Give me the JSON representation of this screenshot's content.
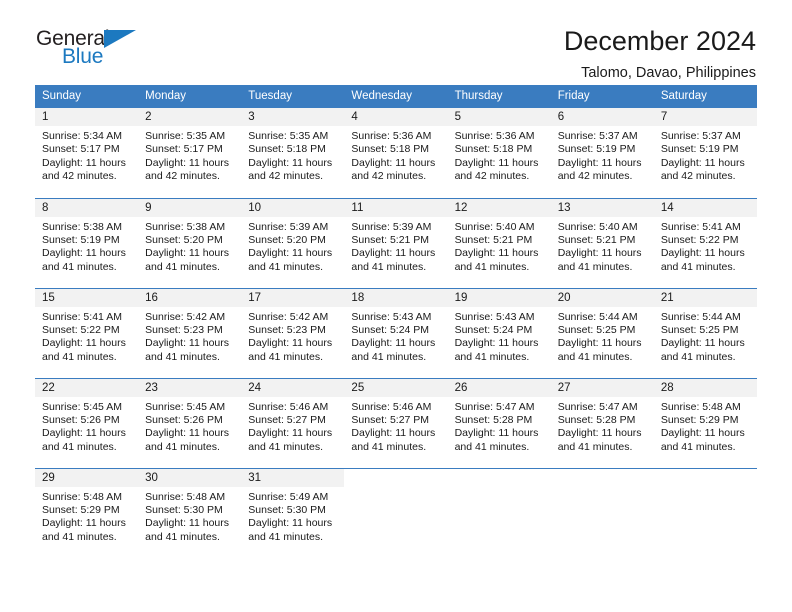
{
  "logo": {
    "primary_text": "General",
    "secondary_text": "Blue",
    "primary_color": "#231f20",
    "secondary_color": "#1c79c0",
    "triangle_icon": "triangle-icon"
  },
  "header": {
    "title": "December 2024",
    "subtitle": "Talomo, Davao, Philippines"
  },
  "theme": {
    "header_bg": "#3a7cc0",
    "daynum_bg": "#f2f2f2",
    "text": "#1a1a1a"
  },
  "weekday_headers": [
    "Sunday",
    "Monday",
    "Tuesday",
    "Wednesday",
    "Thursday",
    "Friday",
    "Saturday"
  ],
  "weeks": [
    [
      {
        "day": "1",
        "sunrise": "Sunrise: 5:34 AM",
        "sunset": "Sunset: 5:17 PM",
        "daylight_1": "Daylight: 11 hours",
        "daylight_2": "and 42 minutes."
      },
      {
        "day": "2",
        "sunrise": "Sunrise: 5:35 AM",
        "sunset": "Sunset: 5:17 PM",
        "daylight_1": "Daylight: 11 hours",
        "daylight_2": "and 42 minutes."
      },
      {
        "day": "3",
        "sunrise": "Sunrise: 5:35 AM",
        "sunset": "Sunset: 5:18 PM",
        "daylight_1": "Daylight: 11 hours",
        "daylight_2": "and 42 minutes."
      },
      {
        "day": "4",
        "sunrise": "Sunrise: 5:36 AM",
        "sunset": "Sunset: 5:18 PM",
        "daylight_1": "Daylight: 11 hours",
        "daylight_2": "and 42 minutes."
      },
      {
        "day": "5",
        "sunrise": "Sunrise: 5:36 AM",
        "sunset": "Sunset: 5:18 PM",
        "daylight_1": "Daylight: 11 hours",
        "daylight_2": "and 42 minutes."
      },
      {
        "day": "6",
        "sunrise": "Sunrise: 5:37 AM",
        "sunset": "Sunset: 5:19 PM",
        "daylight_1": "Daylight: 11 hours",
        "daylight_2": "and 42 minutes."
      },
      {
        "day": "7",
        "sunrise": "Sunrise: 5:37 AM",
        "sunset": "Sunset: 5:19 PM",
        "daylight_1": "Daylight: 11 hours",
        "daylight_2": "and 42 minutes."
      }
    ],
    [
      {
        "day": "8",
        "sunrise": "Sunrise: 5:38 AM",
        "sunset": "Sunset: 5:19 PM",
        "daylight_1": "Daylight: 11 hours",
        "daylight_2": "and 41 minutes."
      },
      {
        "day": "9",
        "sunrise": "Sunrise: 5:38 AM",
        "sunset": "Sunset: 5:20 PM",
        "daylight_1": "Daylight: 11 hours",
        "daylight_2": "and 41 minutes."
      },
      {
        "day": "10",
        "sunrise": "Sunrise: 5:39 AM",
        "sunset": "Sunset: 5:20 PM",
        "daylight_1": "Daylight: 11 hours",
        "daylight_2": "and 41 minutes."
      },
      {
        "day": "11",
        "sunrise": "Sunrise: 5:39 AM",
        "sunset": "Sunset: 5:21 PM",
        "daylight_1": "Daylight: 11 hours",
        "daylight_2": "and 41 minutes."
      },
      {
        "day": "12",
        "sunrise": "Sunrise: 5:40 AM",
        "sunset": "Sunset: 5:21 PM",
        "daylight_1": "Daylight: 11 hours",
        "daylight_2": "and 41 minutes."
      },
      {
        "day": "13",
        "sunrise": "Sunrise: 5:40 AM",
        "sunset": "Sunset: 5:21 PM",
        "daylight_1": "Daylight: 11 hours",
        "daylight_2": "and 41 minutes."
      },
      {
        "day": "14",
        "sunrise": "Sunrise: 5:41 AM",
        "sunset": "Sunset: 5:22 PM",
        "daylight_1": "Daylight: 11 hours",
        "daylight_2": "and 41 minutes."
      }
    ],
    [
      {
        "day": "15",
        "sunrise": "Sunrise: 5:41 AM",
        "sunset": "Sunset: 5:22 PM",
        "daylight_1": "Daylight: 11 hours",
        "daylight_2": "and 41 minutes."
      },
      {
        "day": "16",
        "sunrise": "Sunrise: 5:42 AM",
        "sunset": "Sunset: 5:23 PM",
        "daylight_1": "Daylight: 11 hours",
        "daylight_2": "and 41 minutes."
      },
      {
        "day": "17",
        "sunrise": "Sunrise: 5:42 AM",
        "sunset": "Sunset: 5:23 PM",
        "daylight_1": "Daylight: 11 hours",
        "daylight_2": "and 41 minutes."
      },
      {
        "day": "18",
        "sunrise": "Sunrise: 5:43 AM",
        "sunset": "Sunset: 5:24 PM",
        "daylight_1": "Daylight: 11 hours",
        "daylight_2": "and 41 minutes."
      },
      {
        "day": "19",
        "sunrise": "Sunrise: 5:43 AM",
        "sunset": "Sunset: 5:24 PM",
        "daylight_1": "Daylight: 11 hours",
        "daylight_2": "and 41 minutes."
      },
      {
        "day": "20",
        "sunrise": "Sunrise: 5:44 AM",
        "sunset": "Sunset: 5:25 PM",
        "daylight_1": "Daylight: 11 hours",
        "daylight_2": "and 41 minutes."
      },
      {
        "day": "21",
        "sunrise": "Sunrise: 5:44 AM",
        "sunset": "Sunset: 5:25 PM",
        "daylight_1": "Daylight: 11 hours",
        "daylight_2": "and 41 minutes."
      }
    ],
    [
      {
        "day": "22",
        "sunrise": "Sunrise: 5:45 AM",
        "sunset": "Sunset: 5:26 PM",
        "daylight_1": "Daylight: 11 hours",
        "daylight_2": "and 41 minutes."
      },
      {
        "day": "23",
        "sunrise": "Sunrise: 5:45 AM",
        "sunset": "Sunset: 5:26 PM",
        "daylight_1": "Daylight: 11 hours",
        "daylight_2": "and 41 minutes."
      },
      {
        "day": "24",
        "sunrise": "Sunrise: 5:46 AM",
        "sunset": "Sunset: 5:27 PM",
        "daylight_1": "Daylight: 11 hours",
        "daylight_2": "and 41 minutes."
      },
      {
        "day": "25",
        "sunrise": "Sunrise: 5:46 AM",
        "sunset": "Sunset: 5:27 PM",
        "daylight_1": "Daylight: 11 hours",
        "daylight_2": "and 41 minutes."
      },
      {
        "day": "26",
        "sunrise": "Sunrise: 5:47 AM",
        "sunset": "Sunset: 5:28 PM",
        "daylight_1": "Daylight: 11 hours",
        "daylight_2": "and 41 minutes."
      },
      {
        "day": "27",
        "sunrise": "Sunrise: 5:47 AM",
        "sunset": "Sunset: 5:28 PM",
        "daylight_1": "Daylight: 11 hours",
        "daylight_2": "and 41 minutes."
      },
      {
        "day": "28",
        "sunrise": "Sunrise: 5:48 AM",
        "sunset": "Sunset: 5:29 PM",
        "daylight_1": "Daylight: 11 hours",
        "daylight_2": "and 41 minutes."
      }
    ],
    [
      {
        "day": "29",
        "sunrise": "Sunrise: 5:48 AM",
        "sunset": "Sunset: 5:29 PM",
        "daylight_1": "Daylight: 11 hours",
        "daylight_2": "and 41 minutes."
      },
      {
        "day": "30",
        "sunrise": "Sunrise: 5:48 AM",
        "sunset": "Sunset: 5:30 PM",
        "daylight_1": "Daylight: 11 hours",
        "daylight_2": "and 41 minutes."
      },
      {
        "day": "31",
        "sunrise": "Sunrise: 5:49 AM",
        "sunset": "Sunset: 5:30 PM",
        "daylight_1": "Daylight: 11 hours",
        "daylight_2": "and 41 minutes."
      },
      {
        "day": "",
        "sunrise": "",
        "sunset": "",
        "daylight_1": "",
        "daylight_2": ""
      },
      {
        "day": "",
        "sunrise": "",
        "sunset": "",
        "daylight_1": "",
        "daylight_2": ""
      },
      {
        "day": "",
        "sunrise": "",
        "sunset": "",
        "daylight_1": "",
        "daylight_2": ""
      },
      {
        "day": "",
        "sunrise": "",
        "sunset": "",
        "daylight_1": "",
        "daylight_2": ""
      }
    ]
  ]
}
